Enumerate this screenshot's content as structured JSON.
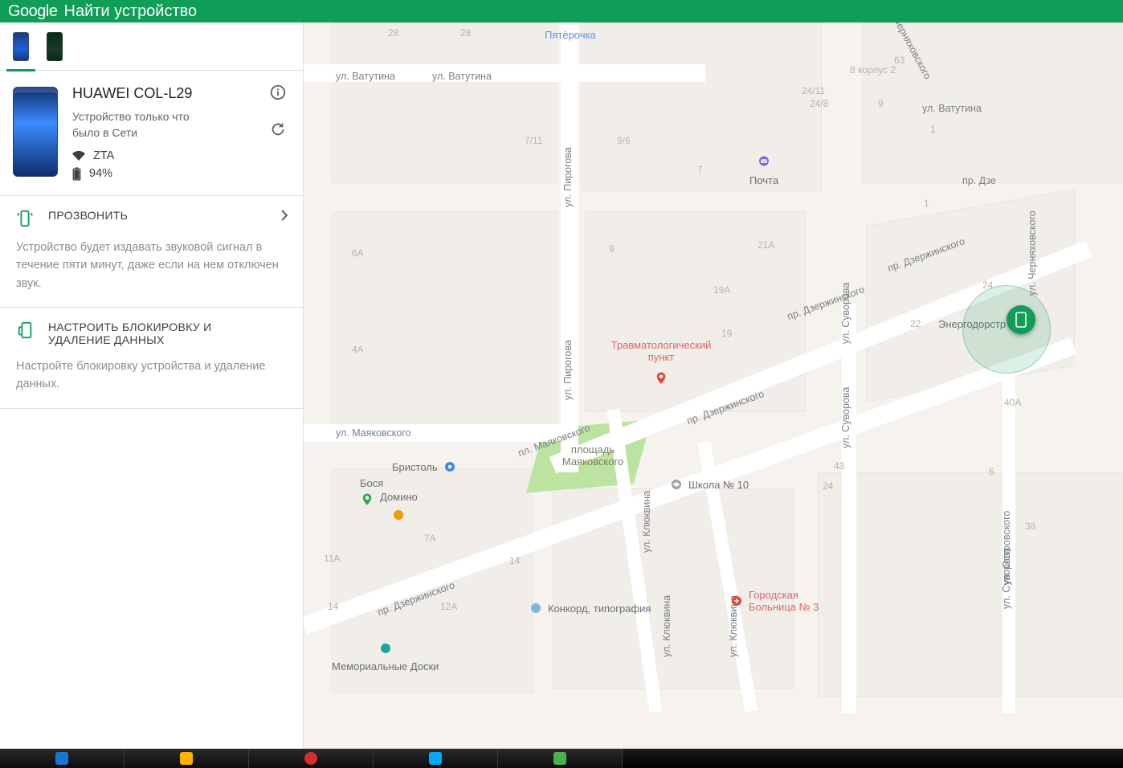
{
  "header": {
    "logo": "Google",
    "title": "Найти устройство"
  },
  "tabs": {
    "selected_index": 0
  },
  "device": {
    "name": "HUAWEI COL-L29",
    "status": "Устройство только что было в Сети",
    "wifi": "ZTA",
    "battery": "94%"
  },
  "actions": {
    "ring": {
      "title": "ПРОЗВОНИТЬ",
      "desc": "Устройство будет издавать звуковой сигнал в течение пяти минут, даже если на нем отключен звук."
    },
    "secure": {
      "title": "НАСТРОИТЬ БЛОКИРОВКУ И УДАЛЕНИЕ ДАННЫХ",
      "desc": "Настройте блокировку устройства и удаление данных."
    }
  },
  "map": {
    "roads": {
      "vatutina": "ул. Ватутина",
      "vatutina2": "ул. Ватутина",
      "vatutina3": "ул. Ватутина",
      "pirogova": "ул. Пирогова",
      "mayakovskogo": "ул. Маяковского",
      "mayakovskogo_pl": "пл. Маяковского",
      "dzerzhinskogo": "пр. Дзержинского",
      "dzerzhinskogo2": "пр. Дзержинского",
      "dzerzhinskogo3": "пр. Дзержинского",
      "suvorova": "ул. Суворова",
      "suvorova2": "ул. Суворова",
      "klyukvina": "ул. Клюквина",
      "klyukvina2": "ул. Клюквина",
      "chernyakhovskogo": "ул. Черняховского",
      "ostrovskogo": "ул. Островского",
      "dzya": "пр. Дзе"
    },
    "pois": {
      "pyaterochka": "Пятёрочка",
      "pochta": "Почта",
      "travmpunkt": "Травматологический пункт",
      "bristol": "Бристоль",
      "bosya": "Бося",
      "domino": "Домино",
      "school10": "Школа № 10",
      "konkord": "Конкорд, типография",
      "hospital3": "Городская Больница № 3",
      "memorial": "Мемориальные Доски",
      "energodorstr": "Энергодорстр",
      "mayak_square": "площадь Маяковского"
    },
    "lots": [
      "28",
      "28",
      "8 корпус 2",
      "63",
      "24/11",
      "24/8",
      "9",
      "7/11",
      "9/6",
      "7",
      "6А",
      "4А",
      "9",
      "21А",
      "19А",
      "22",
      "24",
      "40А",
      "19",
      "38",
      "24",
      "11А",
      "12А",
      "14",
      "7А",
      "14",
      "43",
      "6",
      "1",
      "1"
    ]
  }
}
